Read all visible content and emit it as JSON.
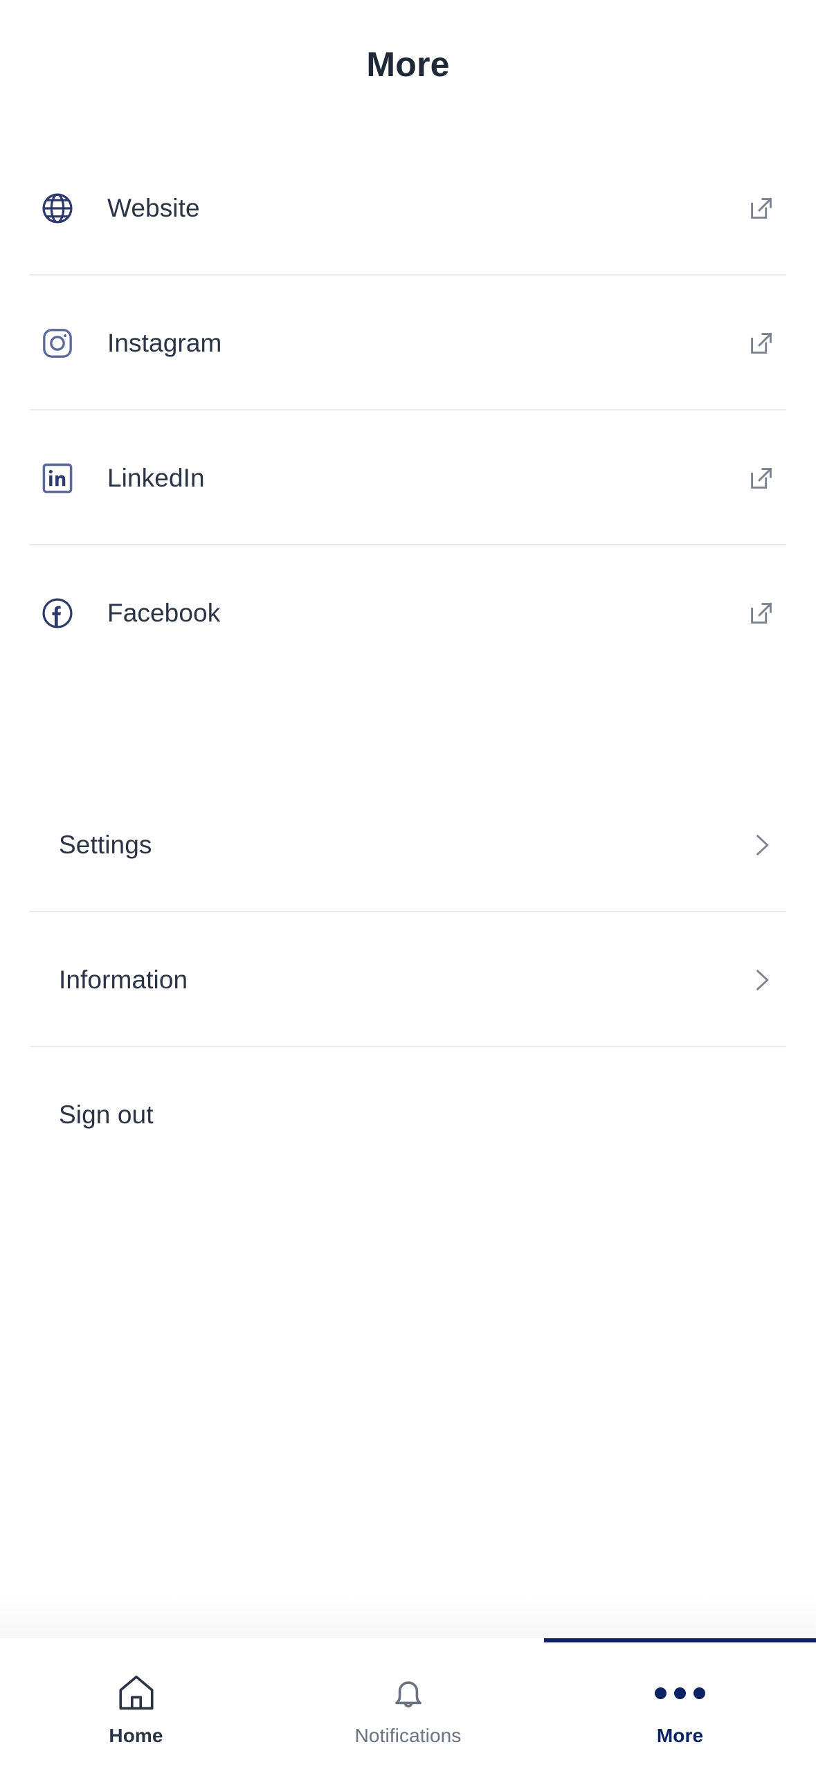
{
  "header": {
    "title": "More"
  },
  "colors": {
    "brand_navy": "#0b2265",
    "icon_navy": "#2d3a6b",
    "text_primary": "#2b3445",
    "text_muted": "#6b7280",
    "divider": "#e8e8ea",
    "background": "#ffffff"
  },
  "social_links": [
    {
      "label": "Website",
      "icon": "globe-icon",
      "action_icon": "external-link-icon"
    },
    {
      "label": "Instagram",
      "icon": "instagram-icon",
      "action_icon": "external-link-icon"
    },
    {
      "label": "LinkedIn",
      "icon": "linkedin-icon",
      "action_icon": "external-link-icon"
    },
    {
      "label": "Facebook",
      "icon": "facebook-icon",
      "action_icon": "external-link-icon"
    }
  ],
  "account_items": [
    {
      "label": "Settings",
      "action_icon": "chevron-right-icon"
    },
    {
      "label": "Information",
      "action_icon": "chevron-right-icon"
    },
    {
      "label": "Sign out",
      "action_icon": ""
    }
  ],
  "bottom_nav": {
    "tabs": [
      {
        "label": "Home",
        "icon": "house-icon",
        "active": false
      },
      {
        "label": "Notifications",
        "icon": "bell-icon",
        "active": false
      },
      {
        "label": "More",
        "icon": "dots-icon",
        "active": true
      }
    ]
  }
}
